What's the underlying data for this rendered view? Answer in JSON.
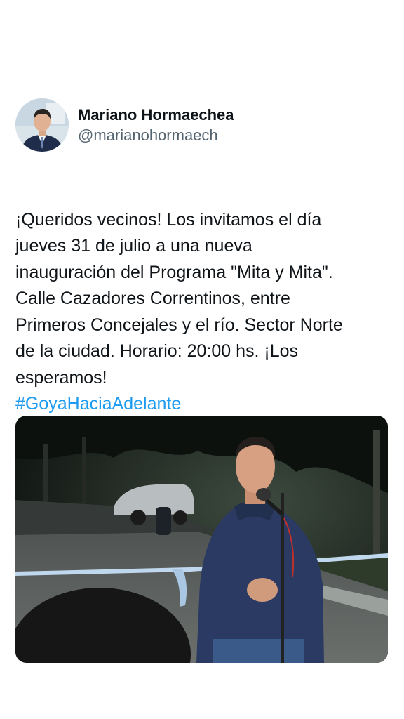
{
  "author": {
    "display_name": "Mariano Hormaechea",
    "handle": "@marianohormaech"
  },
  "tweet": {
    "text": "¡Queridos vecinos! Los invitamos el día\njueves 31 de julio a una nueva\ninauguración del Programa \"Mita y Mita\".\nCalle Cazadores Correntinos, entre\nPrimeros Concejales y el río. Sector Norte\nde la ciudad. Horario: 20:00 hs. ¡Los\nesperamos!",
    "hashtag": "#GoyaHaciaAdelante"
  },
  "colors": {
    "hashtag": "#1d9bf0",
    "handle": "#536471",
    "text": "#0f1419"
  },
  "media": {
    "icon": "photo-icon"
  }
}
